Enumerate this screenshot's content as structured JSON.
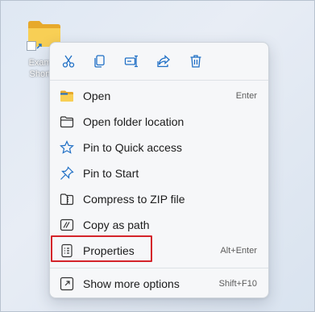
{
  "desktop": {
    "shortcut_label": "Example\nShortcut"
  },
  "toolbar": [
    {
      "name": "cut-button",
      "icon": "scissors-icon"
    },
    {
      "name": "copy-button",
      "icon": "copy-icon"
    },
    {
      "name": "rename-button",
      "icon": "rename-icon"
    },
    {
      "name": "share-button",
      "icon": "share-icon"
    },
    {
      "name": "delete-button",
      "icon": "trash-icon"
    }
  ],
  "menu": {
    "open": {
      "label": "Open",
      "shortcut": "Enter",
      "icon": "folder-color-icon"
    },
    "open_folder_location": {
      "label": "Open folder location",
      "icon": "folder-outline-icon"
    },
    "pin_quick_access": {
      "label": "Pin to Quick access",
      "icon": "star-icon"
    },
    "pin_start": {
      "label": "Pin to Start",
      "icon": "pin-icon"
    },
    "compress_zip": {
      "label": "Compress to ZIP file",
      "icon": "zip-folder-icon"
    },
    "copy_as_path": {
      "label": "Copy as path",
      "icon": "path-icon"
    },
    "properties": {
      "label": "Properties",
      "shortcut": "Alt+Enter",
      "icon": "properties-icon"
    },
    "show_more": {
      "label": "Show more options",
      "shortcut": "Shift+F10",
      "icon": "show-more-icon"
    }
  },
  "colors": {
    "accent_blue": "#1f6fc5",
    "highlight_red": "#d4232a",
    "folder_yellow": "#f5c242"
  }
}
